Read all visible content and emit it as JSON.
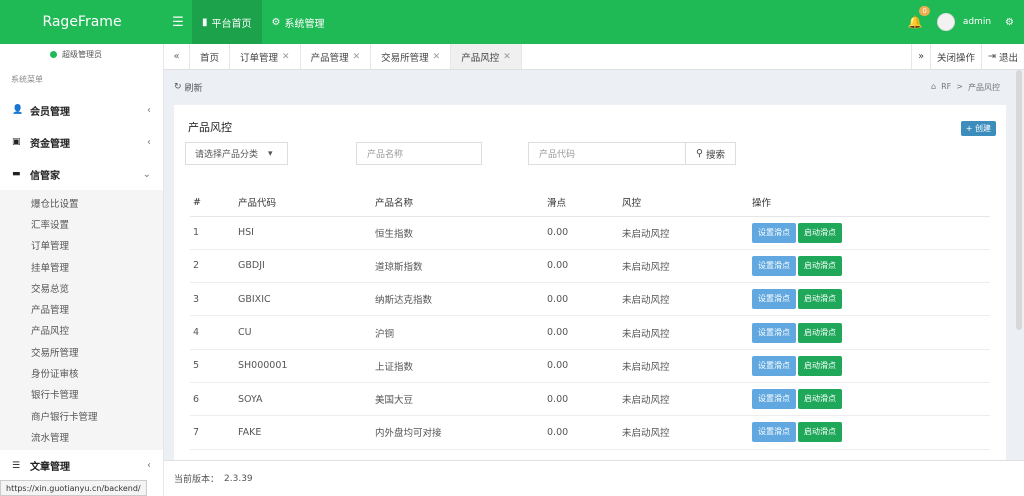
{
  "brand": {
    "logo": "RageFrame"
  },
  "topnav": {
    "menu_icon": "hamburger-icon",
    "items": [
      {
        "label": "平台首页",
        "icon": "bookmark-icon",
        "active": true
      },
      {
        "label": "系统管理",
        "icon": "cogs-icon",
        "active": false
      }
    ],
    "notification_count": "0",
    "user": "admin"
  },
  "sidebar": {
    "user_role": "超级管理员",
    "header": "系统菜单",
    "menus": [
      {
        "label": "会员管理",
        "icon": "user-icon",
        "arrow": "‹"
      },
      {
        "label": "资金管理",
        "icon": "money-icon",
        "arrow": "‹"
      },
      {
        "label": "信管家",
        "icon": "keyboard-icon",
        "arrow": "⌄"
      }
    ],
    "submenu": [
      "爆仓比设置",
      "汇率设置",
      "订单管理",
      "挂单管理",
      "交易总览",
      "产品管理",
      "产品风控",
      "交易所管理",
      "身份证审核",
      "银行卡管理",
      "商户银行卡管理",
      "流水管理"
    ],
    "last_menu": {
      "label": "文章管理",
      "icon": "list-icon",
      "arrow": "‹"
    }
  },
  "tabs": {
    "left_arrow": "«",
    "items": [
      {
        "label": "首页",
        "closable": false
      },
      {
        "label": "订单管理",
        "closable": true
      },
      {
        "label": "产品管理",
        "closable": true
      },
      {
        "label": "交易所管理",
        "closable": true
      },
      {
        "label": "产品风控",
        "closable": true,
        "active": true
      }
    ],
    "right_arrow": "»",
    "close_ops": "关闭操作",
    "logout": "退出"
  },
  "toolbar": {
    "refresh": "刷新",
    "breadcrumb": [
      "RF",
      "产品风控"
    ]
  },
  "panel": {
    "title": "产品风控",
    "create": "+ 创建",
    "filter_category": "请选择产品分类",
    "filter_name_placeholder": "产品名称",
    "filter_code_placeholder": "产品代码",
    "search": "搜索"
  },
  "table": {
    "headers": [
      "#",
      "产品代码",
      "产品名称",
      "滑点",
      "风控",
      "操作"
    ],
    "btn_set": "设置滑点",
    "btn_start": "启动滑点",
    "rows": [
      {
        "id": "1",
        "code": "HSI",
        "name": "恒生指数",
        "slip": "0.00",
        "risk": "未启动风控"
      },
      {
        "id": "2",
        "code": "GBDJI",
        "name": "道琼斯指数",
        "slip": "0.00",
        "risk": "未启动风控"
      },
      {
        "id": "3",
        "code": "GBIXIC",
        "name": "纳斯达克指数",
        "slip": "0.00",
        "risk": "未启动风控"
      },
      {
        "id": "4",
        "code": "CU",
        "name": "沪铜",
        "slip": "0.00",
        "risk": "未启动风控"
      },
      {
        "id": "5",
        "code": "SH000001",
        "name": "上证指数",
        "slip": "0.00",
        "risk": "未启动风控"
      },
      {
        "id": "6",
        "code": "SOYA",
        "name": "美国大豆",
        "slip": "0.00",
        "risk": "未启动风控"
      },
      {
        "id": "7",
        "code": "FAKE",
        "name": "内外盘均可对接",
        "slip": "0.00",
        "risk": "未启动风控"
      }
    ]
  },
  "footer": {
    "version_label": "当前版本：",
    "version": "2.3.39"
  },
  "status_url": "https://xin.guotianyu.cn/backend/"
}
